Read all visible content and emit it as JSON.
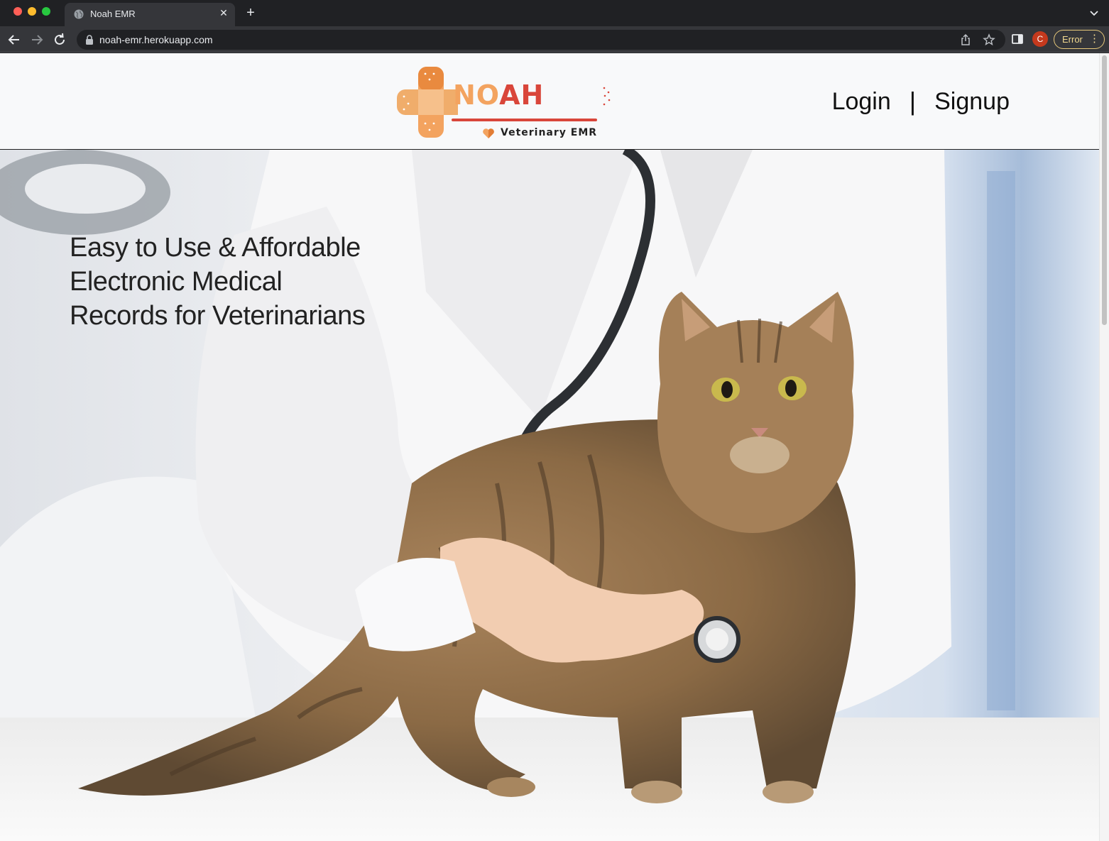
{
  "browser": {
    "tab_title": "Noah EMR",
    "tab_close": "✕",
    "new_tab": "+",
    "url": "noah-emr.herokuapp.com",
    "profile_initial": "C",
    "error_label": "Error",
    "icons": [
      "globe-icon",
      "back-icon",
      "forward-icon",
      "reload-icon",
      "lock-icon",
      "share-icon",
      "star-icon",
      "side-panel-icon",
      "kebab-menu-icon",
      "tab-list-icon"
    ]
  },
  "header": {
    "logo": {
      "brand_part1": "NO",
      "brand_part2": "AH",
      "tagline": "Veterinary EMR",
      "colors": {
        "orange": "#f3a35f",
        "red": "#d9463a"
      }
    },
    "nav": {
      "login": "Login",
      "separator": "|",
      "signup": "Signup"
    }
  },
  "hero": {
    "headline": "Easy to Use & Affordable Electronic Medical Records for Veterinarians",
    "image_subject": "veterinarian examining tabby cat with stethoscope"
  }
}
